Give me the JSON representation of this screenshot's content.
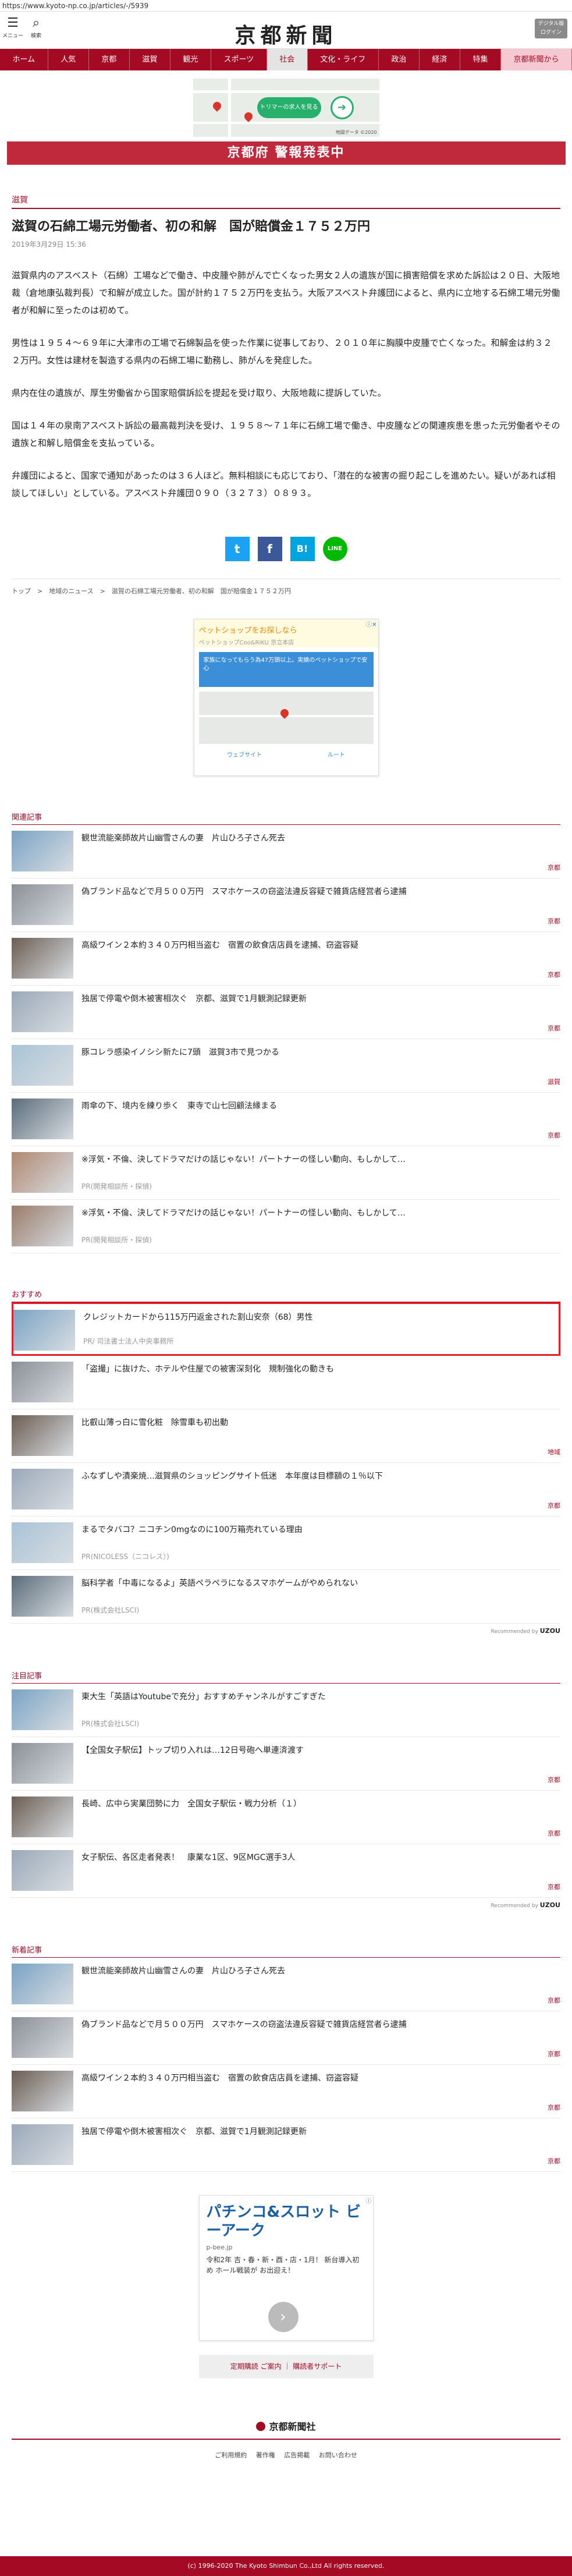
{
  "browser": {
    "url": "https://www.kyoto-np.co.jp/articles/-/5939"
  },
  "header": {
    "menu_label": "メニュー",
    "search_label": "検索",
    "logo": "京都新聞",
    "digital_label_1": "デジタル版",
    "digital_label_2": "ログイン"
  },
  "nav": [
    "ホーム",
    "人気",
    "京都",
    "滋賀",
    "観光",
    "スポーツ",
    "社会",
    "文化・ライフ",
    "政治",
    "経済",
    "特集",
    "京都新聞から"
  ],
  "top_ad": {
    "button": "トリマーの求人を見る",
    "credit": "地図データ ©2020"
  },
  "alert": {
    "text": "京都府 警報発表中"
  },
  "article": {
    "category": "滋賀",
    "headline": "滋賀の石綿工場元労働者、初の和解　国が賠償金１７５２万円",
    "date": "2019年3月29日 15:36",
    "paragraphs": [
      "滋賀県内のアスベスト（石綿）工場などで働き、中皮腫や肺がんで亡くなった男女２人の遺族が国に損害賠償を求めた訴訟は２０日、大阪地裁（倉地康弘裁判長）で和解が成立した。国が計約１７５２万円を支払う。大阪アスベスト弁護団によると、県内に立地する石綿工場元労働者が和解に至ったのは初めて。",
      "男性は１９５４～６９年に大津市の工場で石綿製品を使った作業に従事しており、２０１０年に胸膜中皮腫で亡くなった。和解金は約３２２万円。女性は建材を製造する県内の石綿工場に勤務し、肺がんを発症した。",
      "県内在住の遺族が、厚生労働省から国家賠償訴訟を提起を受け取り、大阪地裁に提訴していた。",
      "国は１４年の泉南アスベスト訴訟の最高裁判決を受け、１９５８～７１年に石綿工場で働き、中皮腫などの関連疾患を患った元労働者やその遺族と和解し賠償金を支払っている。",
      "弁護団によると、国家で通知があったのは３６人ほど。無料相談にも応じており、「潜在的な被害の掘り起こしを進めたい。疑いがあれば相談してほしい」としている。アスベスト弁護団０９０（３２７３）０８９３。"
    ],
    "share": [
      "t",
      "f",
      "B!",
      "LINE"
    ]
  },
  "breadcrumb": "トップ　>　地域のニュース　>　滋賀の石綿工場元労働者、初の和解　国が賠償金１７５２万円",
  "mid_ad": {
    "title": "ペットショップをお探しなら",
    "sub": "ペットショップCoo&RIKU 京立本店",
    "blue": "家族になってもらう為47万頭以上。実績のペットショップで安心",
    "btn_1": "ウェブサイト",
    "btn_2": "ルート"
  },
  "related": {
    "title": "関連記事",
    "items": [
      {
        "title": "観世流能楽師故片山幽雪さんの妻　片山ひろ子さん死去",
        "cat": "京都",
        "sponsor": ""
      },
      {
        "title": "偽ブランド品などで月５００万円　スマホケースの窃盗法違反容疑で雑貨店経営者ら逮捕",
        "cat": "京都",
        "sponsor": ""
      },
      {
        "title": "高級ワイン２本約３４０万円相当盗む　宿置の飲食店店員を逮捕、窃盗容疑",
        "cat": "京都",
        "sponsor": ""
      },
      {
        "title": "独居で停電や倒木被害相次ぐ　京都、滋賀で1月観測記録更新",
        "cat": "京都",
        "sponsor": ""
      },
      {
        "title": "豚コレラ感染イノシシ新たに7頭　滋賀3市で見つかる",
        "cat": "滋賀",
        "sponsor": ""
      },
      {
        "title": "雨傘の下、境内を練り歩く　東寺で山七回顧法縁まる",
        "cat": "京都",
        "sponsor": ""
      },
      {
        "title": "※浮気・不倫、決してドラマだけの話じゃない！パートナーの怪しい動向、もしかして…",
        "cat": "",
        "sponsor": "PR(開発相談所・探偵)"
      },
      {
        "title": "※浮気・不倫、決してドラマだけの話じゃない！パートナーの怪しい動向、もしかして…",
        "cat": "",
        "sponsor": "PR(開発相談所・探偵)"
      }
    ]
  },
  "recommend": {
    "title": "おすすめ",
    "items": [
      {
        "title": "クレジットカードから115万円返金された割山安奈（68）男性",
        "cat": "",
        "sponsor": "PR/ 司法書士法人中央事務所"
      },
      {
        "title": "「盗撮」に抜けた、ホテルや住屋での被害深刻化　規制強化の動きも",
        "cat": "",
        "sponsor": ""
      },
      {
        "title": "比叡山薄っ白に雪化粧　除雪車も初出動",
        "cat": "地域",
        "sponsor": ""
      },
      {
        "title": "ふなずしや漬楽焼…滋賀県のショッピングサイト低迷　本年度は目標額の１％以下",
        "cat": "京都",
        "sponsor": ""
      },
      {
        "title": "まるでタバコ？ニコチン0mgなのに100万箱売れている理由",
        "cat": "",
        "sponsor": "PR(NICOLESS（ニコレス）)"
      },
      {
        "title": "脳科学者「中毒になるよ」英語ペラペラになるスマホゲームがやめられない",
        "cat": "",
        "sponsor": "PR(株式会社LSCI)"
      }
    ],
    "credit_label": "Recommended by",
    "credit_brand": "UZOU"
  },
  "featured": {
    "title": "注目記事",
    "items": [
      {
        "title": "東大生「英語はYoutubeで充分」おすすめチャンネルがすごすぎた",
        "cat": "",
        "sponsor": "PR(株式会社LSCI)"
      },
      {
        "title": "【全国女子駅伝】トップ切り入れは…12日号砲へ単連済渡す",
        "cat": "京都",
        "sponsor": ""
      },
      {
        "title": "長崎、広中ら実業団勢に力　全国女子駅伝・戦力分析（１）",
        "cat": "京都",
        "sponsor": ""
      },
      {
        "title": "女子駅伝、各区走者発表！　康業な1区、9区MGC選手3人",
        "cat": "京都",
        "sponsor": ""
      }
    ],
    "credit_label": "Recommended by",
    "credit_brand": "UZOU"
  },
  "latest": {
    "title": "新着記事",
    "items": [
      {
        "title": "観世流能楽師故片山幽雪さんの妻　片山ひろ子さん死去",
        "cat": "京都",
        "sponsor": ""
      },
      {
        "title": "偽ブランド品などで月５００万円　スマホケースの窃盗法違反容疑で雑貨店経営者ら逮捕",
        "cat": "京都",
        "sponsor": ""
      },
      {
        "title": "高級ワイン２本約３４０万円相当盗む　宿置の飲食店店員を逮捕、窃盗容疑",
        "cat": "京都",
        "sponsor": ""
      },
      {
        "title": "独居で停電や倒木被害相次ぐ　京都、滋賀で1月観測記録更新",
        "cat": "京都",
        "sponsor": ""
      }
    ]
  },
  "bottom_ad": {
    "title": "パチンコ&スロット ビーアーク",
    "domain": "p-bee.jp",
    "desc": "令和2年 吉・春・新・酉・店・1月！ 新台導入初め ホール戦装が お出迎え！"
  },
  "footer": {
    "pill": "定期購読 ご案内 ｜ 購読者サポート",
    "logo": "京都新聞社",
    "links": "ご利用規約 著作権 広告掲載 お問い合わせ",
    "copyright": "(c) 1996-2020 The Kyoto Shimbun Co.,Ltd All rights reserved."
  },
  "colors": {
    "brand": "#a50a24",
    "alert": "#c0283c"
  }
}
